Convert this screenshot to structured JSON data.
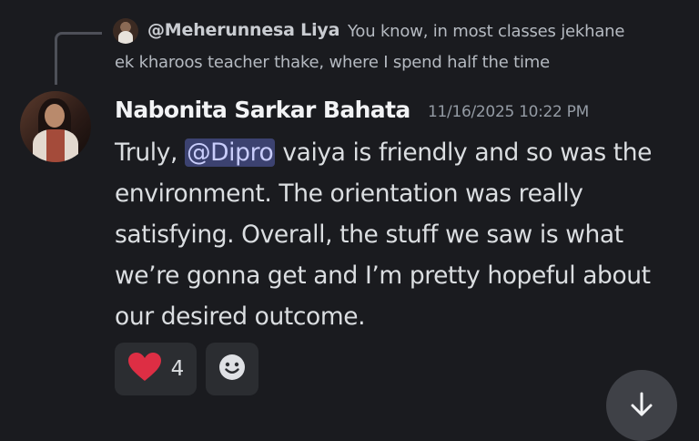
{
  "reply": {
    "author": "@Meherunnesa Liya",
    "text_line1": "You know, in most classes jekhane",
    "text_line2": "ek kharoos teacher thake, where I spend half the time"
  },
  "message": {
    "author": "Nabonita Sarkar Bahata",
    "timestamp": "11/16/2025 10:22 PM",
    "line1_before": "Truly, ",
    "mention": "@Dipro",
    "line1_after": " vaiya is friendly and so was the",
    "line2": "environment. The orientation was really",
    "line3": "satisfying. Overall, the stuff we saw is what",
    "line4": "we’re gonna get and I’m pretty hopeful about",
    "line5": "our desired outcome."
  },
  "reactions": {
    "heart": {
      "icon": "heart-icon",
      "count": "4",
      "color": "#dd2e44"
    },
    "add_reaction_icon": "smiley-icon"
  },
  "scroll": {
    "icon": "arrow-down-icon"
  },
  "colors": {
    "background": "#1a1b1f",
    "mention_bg": "#3c4270",
    "pill_bg": "#2b2d31"
  }
}
